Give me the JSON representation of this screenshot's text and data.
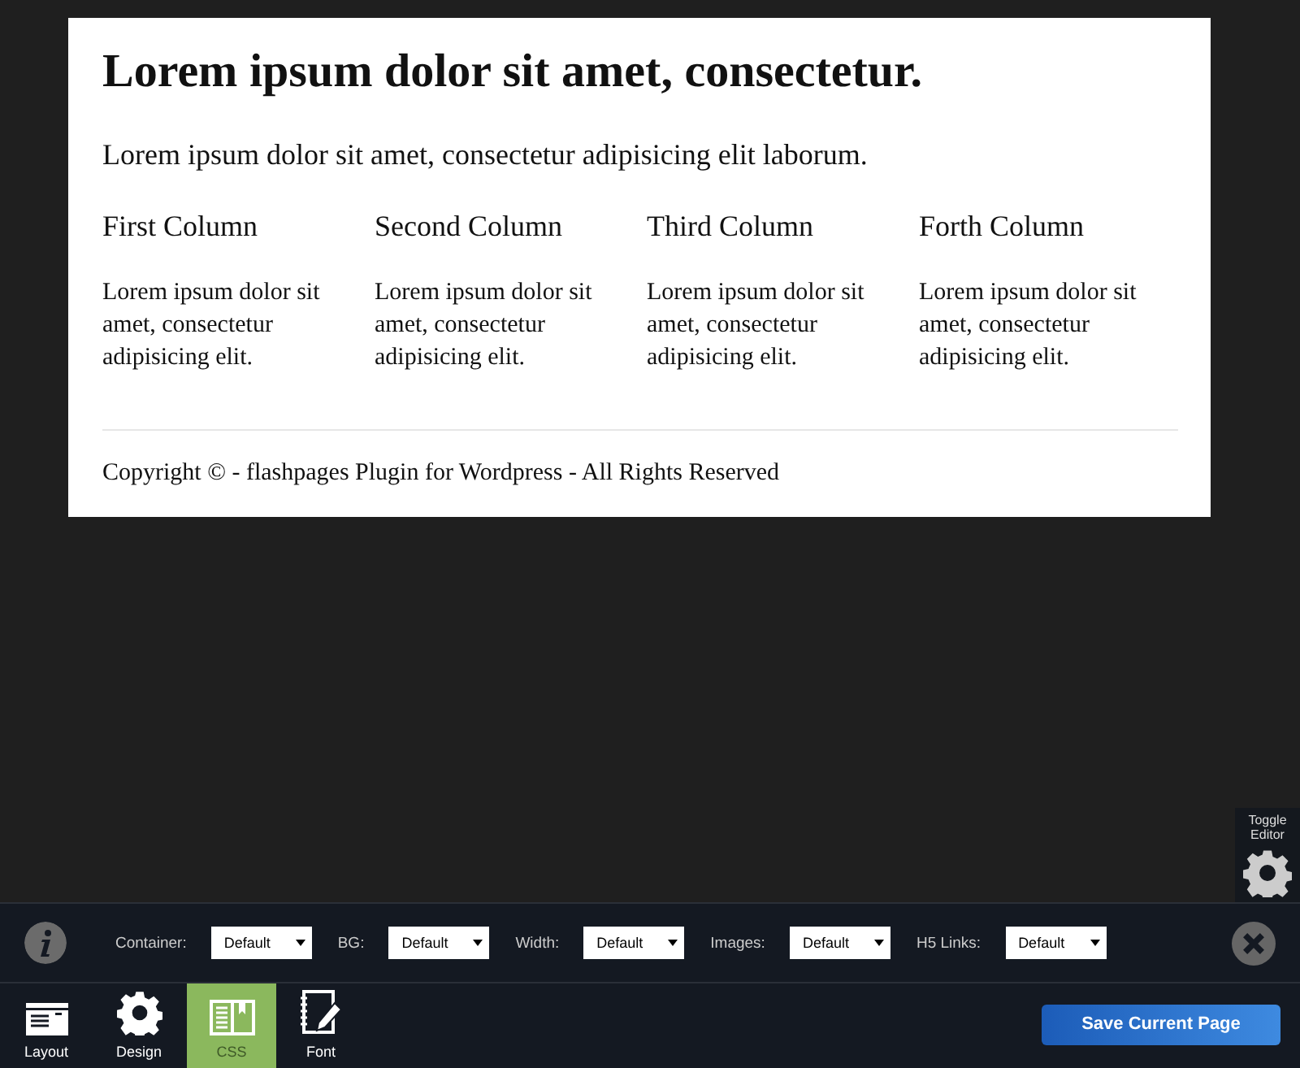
{
  "content": {
    "title": "Lorem ipsum dolor sit amet, consectetur.",
    "intro": "Lorem ipsum dolor sit amet, consectetur adipisicing elit laborum.",
    "columns": [
      {
        "heading": "First Column",
        "text": "Lorem ipsum dolor sit amet, consectetur adipisicing elit."
      },
      {
        "heading": "Second Column",
        "text": "Lorem ipsum dolor sit amet, consectetur adipisicing elit."
      },
      {
        "heading": "Third Column",
        "text": "Lorem ipsum dolor sit amet, consectetur adipisicing elit."
      },
      {
        "heading": "Forth Column",
        "text": "Lorem ipsum dolor sit amet, consectetur adipisicing elit."
      }
    ],
    "footer": "Copyright © - flashpages Plugin for Wordpress - All Rights Reserved"
  },
  "toggle_editor": {
    "label": "Toggle Editor"
  },
  "settings": [
    {
      "label": "Container:",
      "value": "Default"
    },
    {
      "label": "BG:",
      "value": "Default"
    },
    {
      "label": "Width:",
      "value": "Default"
    },
    {
      "label": "Images:",
      "value": "Default"
    },
    {
      "label": "H5 Links:",
      "value": "Default"
    }
  ],
  "tabs": [
    {
      "label": "Layout",
      "selected": false
    },
    {
      "label": "Design",
      "selected": false
    },
    {
      "label": "CSS",
      "selected": true
    },
    {
      "label": "Font",
      "selected": false
    }
  ],
  "save_button": "Save Current Page"
}
